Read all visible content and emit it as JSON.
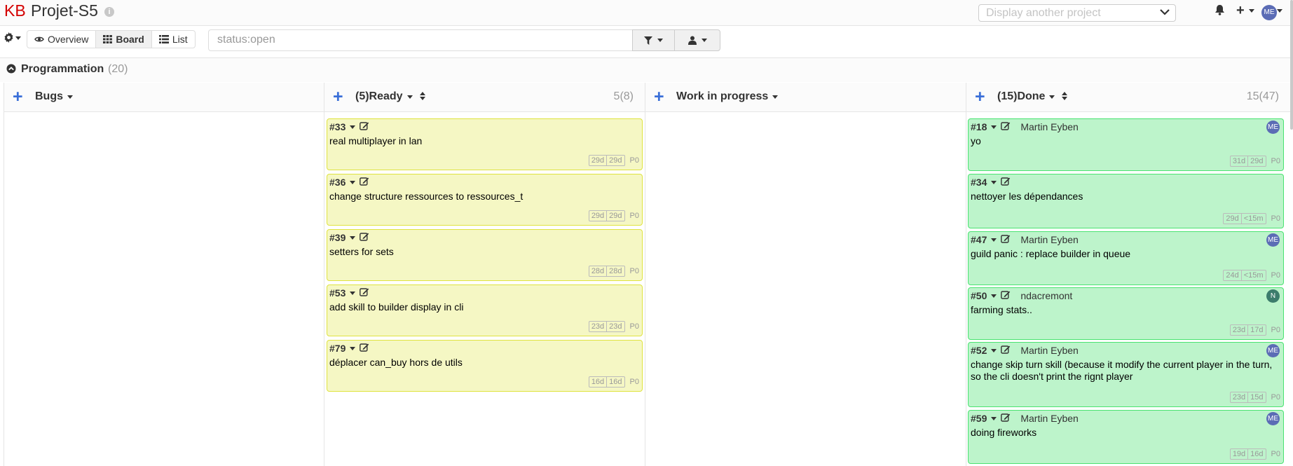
{
  "header": {
    "logo": "KB",
    "project_title": "Projet-S5",
    "project_select_placeholder": "Display another project",
    "user_initials": "ME"
  },
  "toolbar": {
    "views": [
      {
        "label": "Overview",
        "icon": "eye-icon"
      },
      {
        "label": "Board",
        "icon": "th-icon",
        "active": true
      },
      {
        "label": "List",
        "icon": "list-icon"
      }
    ],
    "filter_value": "status:open"
  },
  "swimlane": {
    "title": "Programmation",
    "count": "(20)"
  },
  "columns": [
    {
      "title": "Bugs",
      "count": ""
    },
    {
      "title": "(5)Ready",
      "count": "5(8)"
    },
    {
      "title": "Work in progress",
      "count": ""
    },
    {
      "title": "(15)Done",
      "count": "15(47)"
    }
  ],
  "ready_tasks": [
    {
      "id": "#33",
      "title": "real multiplayer in lan",
      "age1": "29d",
      "age2": "29d",
      "priority": "P0"
    },
    {
      "id": "#36",
      "title": "change structure ressources to ressources_t",
      "age1": "29d",
      "age2": "29d",
      "priority": "P0"
    },
    {
      "id": "#39",
      "title": "setters for sets",
      "age1": "28d",
      "age2": "28d",
      "priority": "P0"
    },
    {
      "id": "#53",
      "title": "add skill to builder display in cli",
      "age1": "23d",
      "age2": "23d",
      "priority": "P0"
    },
    {
      "id": "#79",
      "title": "déplacer can_buy hors de utils",
      "age1": "16d",
      "age2": "16d",
      "priority": "P0"
    }
  ],
  "done_tasks": [
    {
      "id": "#18",
      "assignee": "Martin Eyben",
      "avatar": "ME",
      "title": "yo",
      "age1": "31d",
      "age2": "29d",
      "priority": "P0"
    },
    {
      "id": "#34",
      "assignee": "",
      "avatar": "",
      "title": "nettoyer les dépendances",
      "age1": "29d",
      "age2": "<15m",
      "priority": "P0"
    },
    {
      "id": "#47",
      "assignee": "Martin Eyben",
      "avatar": "ME",
      "title": "guild panic : replace builder in queue",
      "age1": "24d",
      "age2": "<15m",
      "priority": "P0"
    },
    {
      "id": "#50",
      "assignee": "ndacremont",
      "avatar": "N",
      "title": "farming stats..",
      "age1": "23d",
      "age2": "17d",
      "priority": "P0"
    },
    {
      "id": "#52",
      "assignee": "Martin Eyben",
      "avatar": "ME",
      "title": "change skip turn skill (because it modify the current player in the turn, so the cli doesn't print the rignt player",
      "age1": "23d",
      "age2": "15d",
      "priority": "P0"
    },
    {
      "id": "#59",
      "assignee": "Martin Eyben",
      "avatar": "ME",
      "title": "doing fireworks",
      "age1": "19d",
      "age2": "16d",
      "priority": "P0"
    }
  ]
}
